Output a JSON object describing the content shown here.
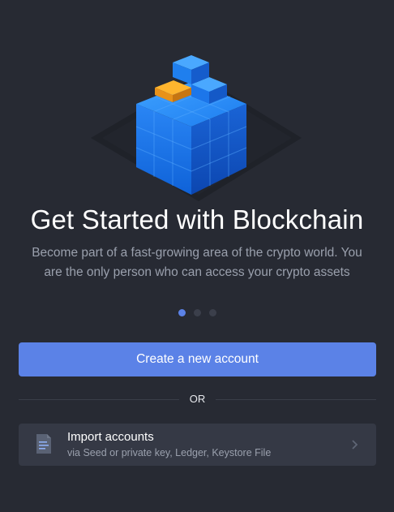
{
  "onboarding": {
    "title": "Get Started with Blockchain",
    "subtitle": "Become part of a fast-growing area of the crypto world. You are the only person who can access your crypto assets",
    "carousel": {
      "page_count": 3,
      "active_page": 1
    }
  },
  "actions": {
    "create_label": "Create a new account",
    "or_label": "OR",
    "import": {
      "title": "Import accounts",
      "subtitle": "via Seed or private key, Ledger, Keystore File",
      "icon": "document-icon",
      "chevron": "chevron-right-icon"
    }
  },
  "colors": {
    "background": "#272a33",
    "accent": "#5b82e7",
    "card": "#353945",
    "muted_text": "#9aa0ad",
    "cube_highlight": "#f5a623"
  }
}
